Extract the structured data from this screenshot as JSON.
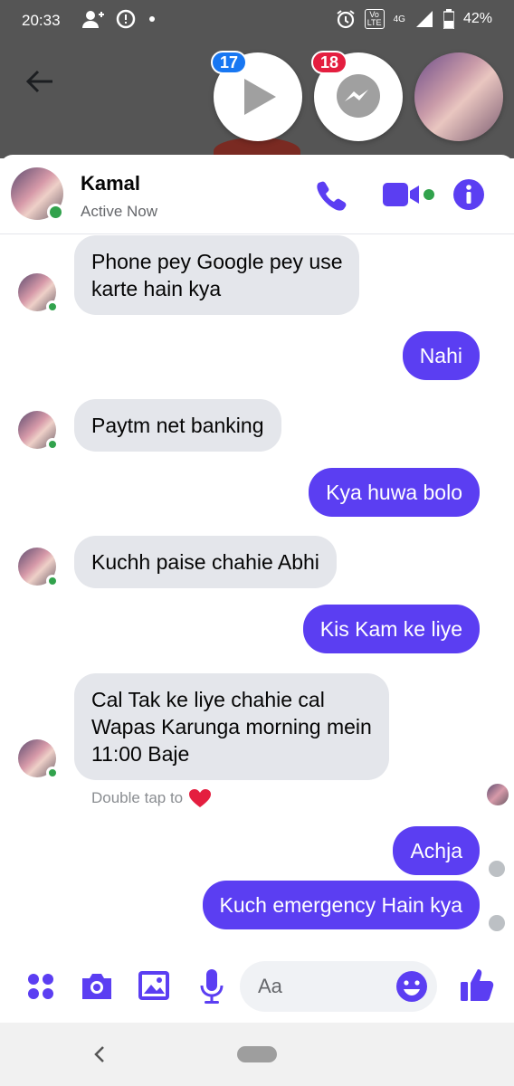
{
  "status_bar": {
    "time": "20:33",
    "battery": "42%",
    "network": "4G",
    "volte": "Vo LTE",
    "icons": [
      "add-person-icon",
      "messenger-notification-icon",
      "dot-icon",
      "alarm-icon",
      "volte-icon",
      "signal-icon",
      "battery-icon"
    ]
  },
  "chat_heads": {
    "play_badge": "17",
    "messenger_badge": "18"
  },
  "header": {
    "name": "Kamal",
    "status": "Active Now",
    "accent": "#5b3ef2"
  },
  "messages": [
    {
      "from": "them",
      "lines": [
        "Phone pey Google pey use",
        "karte hain kya"
      ]
    },
    {
      "from": "me",
      "lines": [
        "Nahi"
      ]
    },
    {
      "from": "them",
      "lines": [
        "Paytm net banking"
      ]
    },
    {
      "from": "me",
      "lines": [
        "Kya huwa bolo"
      ]
    },
    {
      "from": "them",
      "lines": [
        "Kuchh paise chahie Abhi"
      ]
    },
    {
      "from": "me",
      "lines": [
        "Kis Kam ke liye"
      ]
    },
    {
      "from": "them",
      "lines": [
        "Cal Tak ke liye chahie cal",
        "Wapas Karunga morning mein",
        "11:00 Baje"
      ]
    },
    {
      "from": "me",
      "lines": [
        "Achja"
      ]
    },
    {
      "from": "me",
      "lines": [
        "Kuch emergency Hain kya"
      ]
    }
  ],
  "tap_hint": "Double tap to",
  "composer": {
    "placeholder": "Aa"
  },
  "colors": {
    "accent": "#5b3ef2",
    "incoming_bubble": "#e4e6eb",
    "online": "#31a24c",
    "badge_blue": "#1877f2",
    "badge_red": "#e41e3f"
  }
}
